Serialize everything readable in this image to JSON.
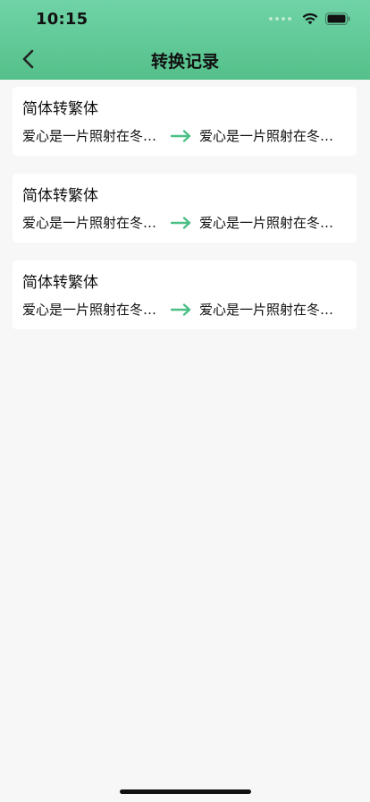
{
  "status_bar": {
    "time": "10:15"
  },
  "nav": {
    "title": "转换记录"
  },
  "records": [
    {
      "title": "简体转繁体",
      "source": "爱心是一片照射在冬…",
      "target": "爱心是一片照射在冬…"
    },
    {
      "title": "简体转繁体",
      "source": "爱心是一片照射在冬…",
      "target": "爱心是一片照射在冬…"
    },
    {
      "title": "简体转繁体",
      "source": "爱心是一片照射在冬…",
      "target": "爱心是一片照射在冬…"
    }
  ],
  "colors": {
    "header_gradient_top": "#6fd3a7",
    "header_gradient_bottom": "#55c08a",
    "arrow": "#4cbf86",
    "background": "#f7f7f7"
  },
  "icons": {
    "back": "chevron-left-icon",
    "arrow": "arrow-right-icon",
    "wifi": "wifi-icon",
    "battery": "battery-icon"
  }
}
